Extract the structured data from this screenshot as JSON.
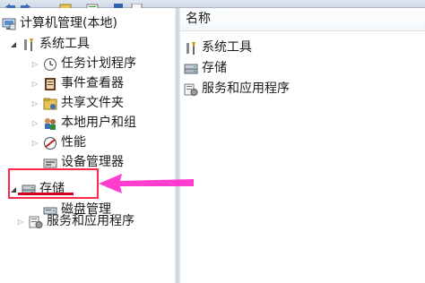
{
  "tree": {
    "root": {
      "label": "计算机管理(本地)",
      "icon": "computer-management-icon"
    },
    "items": [
      {
        "label": "系统工具",
        "icon": "tools-icon"
      },
      {
        "label": "任务计划程序",
        "icon": "clock-icon"
      },
      {
        "label": "事件查看器",
        "icon": "event-viewer-icon"
      },
      {
        "label": "共享文件夹",
        "icon": "shared-folder-icon"
      },
      {
        "label": "本地用户和组",
        "icon": "users-icon"
      },
      {
        "label": "性能",
        "icon": "performance-icon"
      },
      {
        "label": "设备管理器",
        "icon": "device-manager-icon"
      },
      {
        "label": "存储",
        "icon": "storage-icon"
      },
      {
        "label": "磁盘管理",
        "icon": "disk-management-icon"
      },
      {
        "label": "服务和应用程序",
        "icon": "services-icon"
      }
    ]
  },
  "list": {
    "header": "名称",
    "items": [
      {
        "label": "系统工具",
        "icon": "tools-icon"
      },
      {
        "label": "存储",
        "icon": "storage-icon"
      },
      {
        "label": "服务和应用程序",
        "icon": "services-icon"
      }
    ]
  },
  "colors": {
    "annotation_arrow": "#ff33cc",
    "annotation_box": "#ff2a4a",
    "annotation_underline": "#d2001e"
  }
}
